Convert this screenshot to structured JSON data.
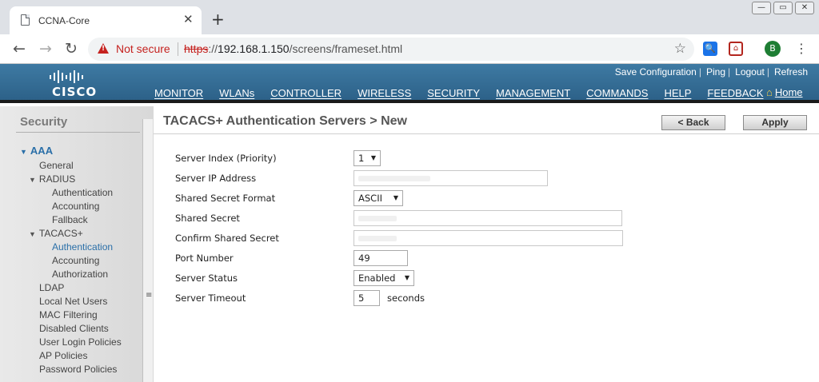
{
  "browser": {
    "tab_title": "CCNA-Core",
    "tab_close": "✕",
    "new_tab": "+",
    "win_minimize": "—",
    "win_restore": "▭",
    "win_close": "✕",
    "security_text": "Not secure",
    "url_scheme": "https",
    "url_sep": "://",
    "url_host": "192.168.1.150",
    "url_path": "/screens/frameset.html",
    "profile_initial": "B",
    "ext_search": "🔍",
    "ext_pocket": "⌂",
    "back": "←",
    "forward": "→",
    "reload": "↻",
    "star": "☆",
    "menu": "⋮"
  },
  "header": {
    "logo_text": "CISCO",
    "top_links": [
      "Save Configuration",
      "Ping",
      "Logout",
      "Refresh"
    ],
    "menu": [
      {
        "label": "MONITOR",
        "active": false
      },
      {
        "label": "WLANs",
        "active": false
      },
      {
        "label": "CONTROLLER",
        "active": false
      },
      {
        "label": "WIRELESS",
        "active": false
      },
      {
        "label": "SECURITY",
        "active": true
      },
      {
        "label": "MANAGEMENT",
        "active": false
      },
      {
        "label": "COMMANDS",
        "active": false
      },
      {
        "label": "HELP",
        "active": false
      },
      {
        "label": "FEEDBACK",
        "active": false
      }
    ],
    "home_label": "Home",
    "home_icon": "⌂",
    "accent_color": "#f29a2e"
  },
  "sidebar": {
    "title": "Security",
    "tree": {
      "aaa": "AAA",
      "general": "General",
      "radius": "RADIUS",
      "radius_authentication": "Authentication",
      "radius_accounting": "Accounting",
      "radius_fallback": "Fallback",
      "tacacs": "TACACS+",
      "tacacs_authentication": "Authentication",
      "tacacs_accounting": "Accounting",
      "tacacs_authorization": "Authorization",
      "ldap": "LDAP",
      "local_net_users": "Local Net Users",
      "mac_filtering": "MAC Filtering",
      "disabled_clients": "Disabled Clients",
      "user_login_policies": "User Login Policies",
      "ap_policies": "AP Policies",
      "password_policies": "Password Policies"
    },
    "expanded_icon": "▼",
    "grip": "≡"
  },
  "content": {
    "title": "TACACS+ Authentication Servers > New",
    "back_label": "< Back",
    "apply_label": "Apply",
    "form": {
      "server_index": {
        "label": "Server Index (Priority)",
        "value": "1"
      },
      "server_ip": {
        "label": "Server IP Address",
        "value": ""
      },
      "secret_format": {
        "label": "Shared Secret Format",
        "value": "ASCII"
      },
      "shared_secret": {
        "label": "Shared Secret",
        "value": ""
      },
      "confirm_secret": {
        "label": "Confirm Shared Secret",
        "value": ""
      },
      "port": {
        "label": "Port Number",
        "value": "49"
      },
      "status": {
        "label": "Server Status",
        "value": "Enabled"
      },
      "timeout": {
        "label": "Server Timeout",
        "value": "5",
        "unit": "seconds"
      }
    },
    "caret": "▼"
  }
}
